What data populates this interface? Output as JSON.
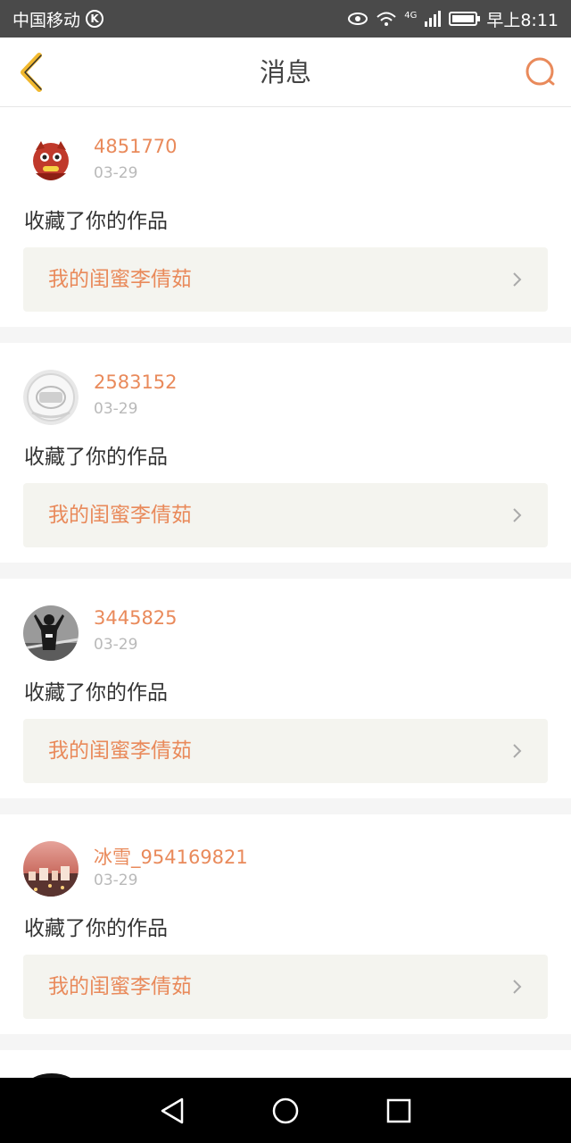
{
  "status_bar": {
    "carrier": "中国移动",
    "carrier_badge": "K",
    "network": "4G",
    "time": "早上8:11"
  },
  "header": {
    "title": "消息",
    "back_icon": "back-chevron-icon",
    "search_icon": "search-icon"
  },
  "colors": {
    "accent": "#e98a5b",
    "back_icon": "#f1b82e",
    "work_box_bg": "#f4f4ef"
  },
  "messages": [
    {
      "username": "4851770",
      "date": "03-29",
      "action": "收藏了你的作品",
      "work_title": "我的闺蜜李倩茹",
      "avatar": "red-dragon-avatar"
    },
    {
      "username": "2583152",
      "date": "03-29",
      "action": "收藏了你的作品",
      "work_title": "我的闺蜜李倩茹",
      "avatar": "white-globe-avatar"
    },
    {
      "username": "3445825",
      "date": "03-29",
      "action": "收藏了你的作品",
      "work_title": "我的闺蜜李倩茹",
      "avatar": "person-photo-avatar"
    },
    {
      "username": "冰雪_954169821",
      "date": "03-29",
      "action": "收藏了你的作品",
      "work_title": "我的闺蜜李倩茹",
      "avatar": "sunset-town-avatar"
    }
  ]
}
